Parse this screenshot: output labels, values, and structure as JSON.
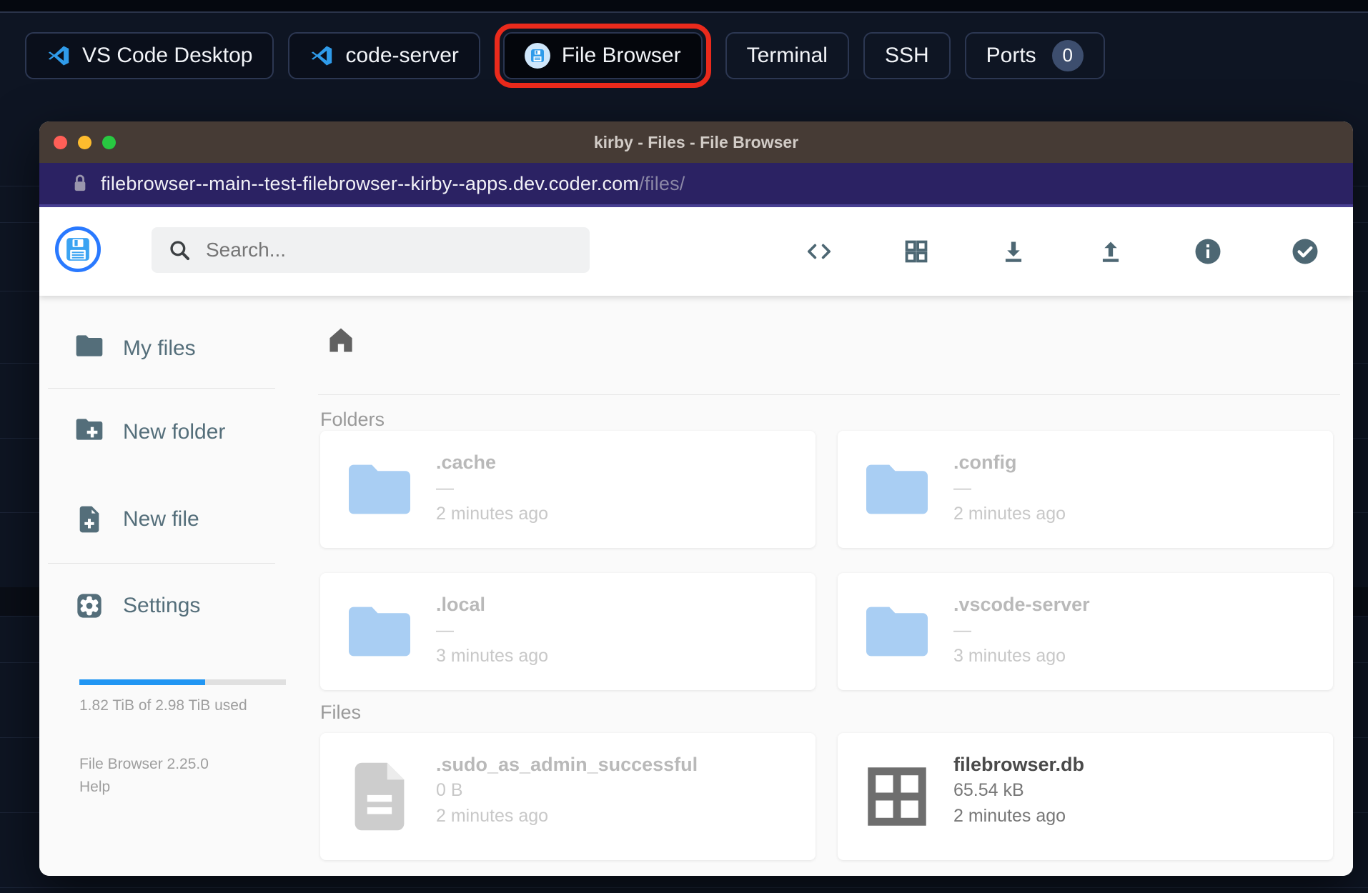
{
  "topbar": {
    "buttons": [
      {
        "label": "VS Code Desktop"
      },
      {
        "label": "code-server"
      },
      {
        "label": "File Browser"
      },
      {
        "label": "Terminal"
      },
      {
        "label": "SSH"
      },
      {
        "label": "Ports",
        "badge": "0"
      }
    ]
  },
  "window": {
    "title": "kirby - Files - File Browser",
    "url_host": "filebrowser--main--test-filebrowser--kirby--apps.dev.coder.com",
    "url_path": "/files/"
  },
  "header": {
    "search_placeholder": "Search...",
    "icons": [
      "code",
      "grid-view",
      "download",
      "upload",
      "info",
      "check-circle"
    ]
  },
  "sidebar": {
    "items": [
      {
        "label": "My files"
      },
      {
        "label": "New folder"
      },
      {
        "label": "New file"
      },
      {
        "label": "Settings"
      }
    ],
    "storage": {
      "used_text": "1.82 TiB of 2.98 TiB used",
      "percent_used": 61
    },
    "version": "File Browser 2.25.0",
    "help_label": "Help"
  },
  "content": {
    "sections": {
      "folders_label": "Folders",
      "files_label": "Files"
    },
    "folders": [
      {
        "name": ".cache",
        "size": "—",
        "modified": "2 minutes ago"
      },
      {
        "name": ".config",
        "size": "—",
        "modified": "2 minutes ago"
      },
      {
        "name": ".local",
        "size": "—",
        "modified": "3 minutes ago"
      },
      {
        "name": ".vscode-server",
        "size": "—",
        "modified": "3 minutes ago"
      }
    ],
    "files": [
      {
        "name": ".sudo_as_admin_successful",
        "size": "0 B",
        "modified": "2 minutes ago"
      },
      {
        "name": "filebrowser.db",
        "size": "65.54 kB",
        "modified": "2 minutes ago"
      }
    ]
  },
  "colors": {
    "accent_blue": "#2196f3",
    "highlight_red": "#ea2a1c",
    "folder_blue": "#a9cef3",
    "slate_icon": "#546e7a"
  }
}
